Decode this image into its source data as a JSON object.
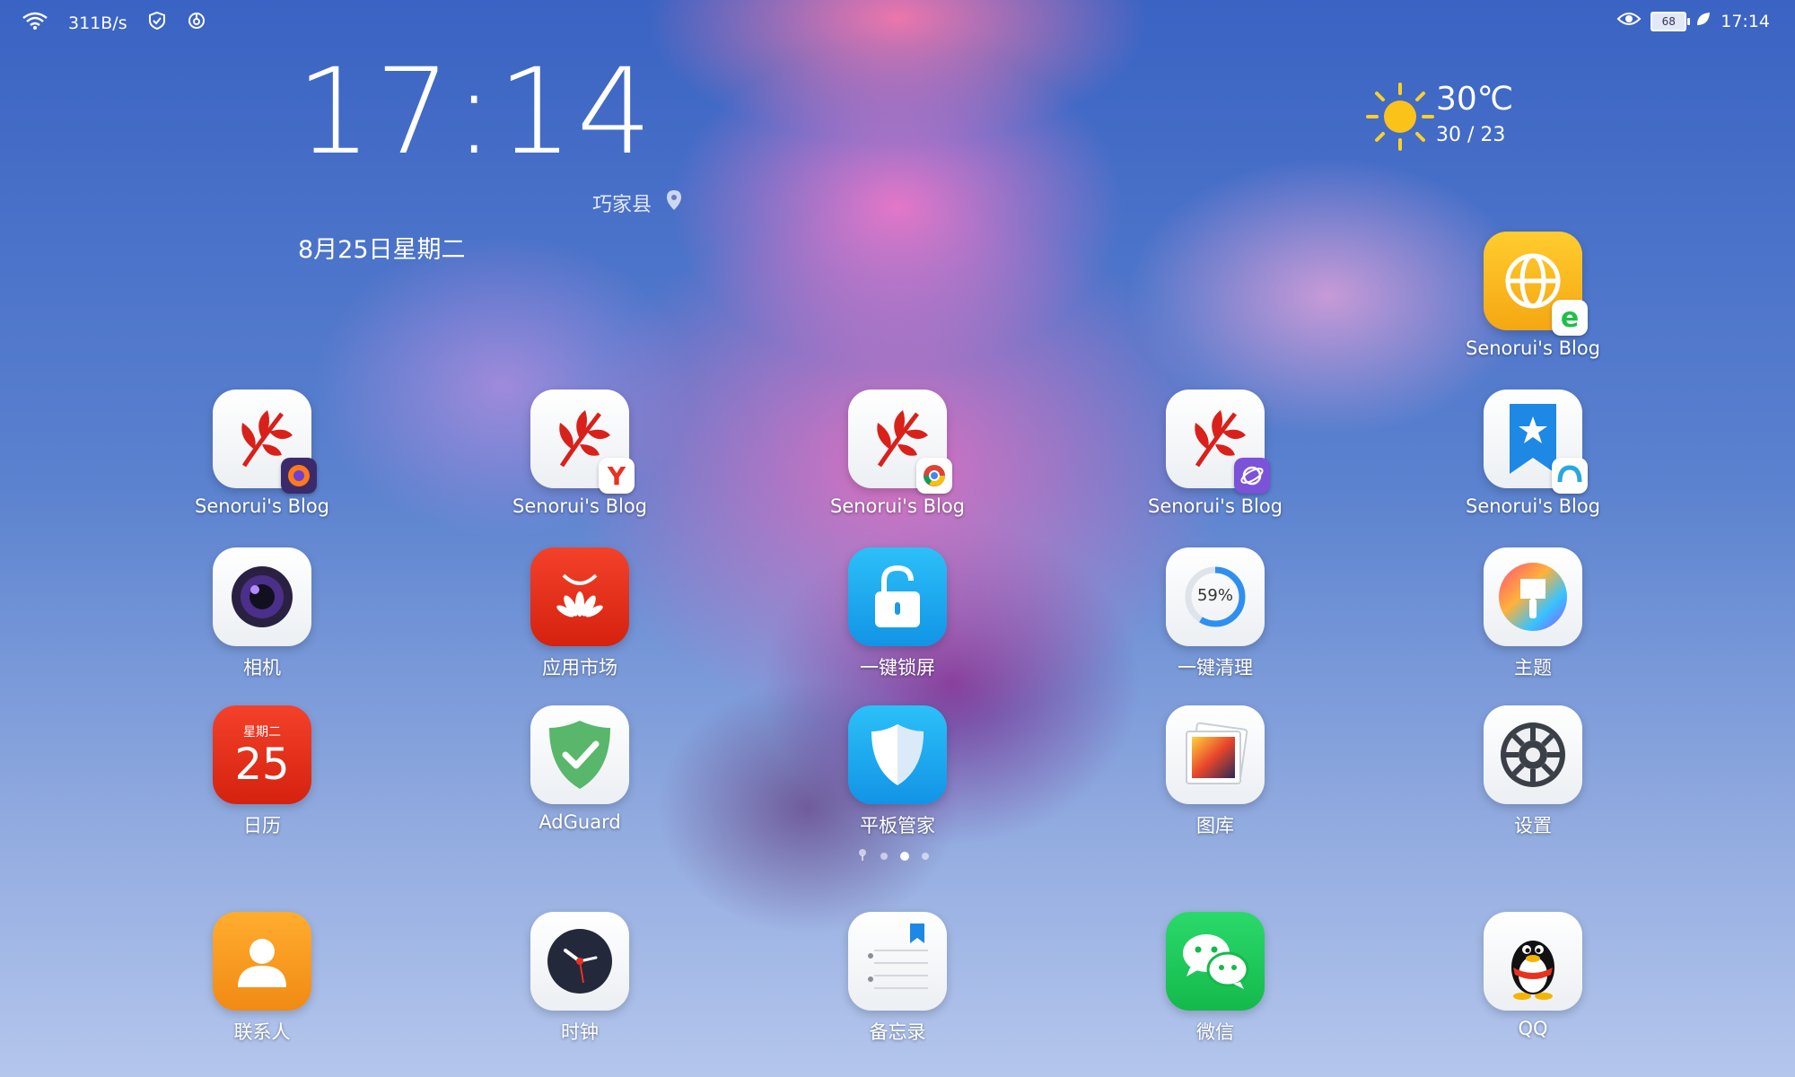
{
  "status_bar": {
    "net_speed": "311B/s",
    "battery_level": "68",
    "time": "17:14"
  },
  "clock_widget": {
    "time": "17:14",
    "location": "巧家县",
    "date": "8月25日星期二"
  },
  "weather_widget": {
    "temperature": "30℃",
    "range": "30 / 23",
    "icon": "sun-icon"
  },
  "apps": {
    "blog_e": "Senorui's Blog",
    "blog_firefox": "Senorui's Blog",
    "blog_yandex": "Senorui's Blog",
    "blog_chrome": "Senorui's Blog",
    "blog_browser": "Senorui's Blog",
    "blog_bookmark": "Senorui's Blog",
    "camera": "相机",
    "app_market": "应用市场",
    "lock_screen": "一键锁屏",
    "cleanup": "一键清理",
    "cleanup_percent": "59%",
    "themes": "主题",
    "calendar": "日历",
    "calendar_weekday": "星期二",
    "calendar_day": "25",
    "adguard": "AdGuard",
    "tablet_manager": "平板管家",
    "gallery": "图库",
    "settings": "设置"
  },
  "dock": {
    "contacts": "联系人",
    "clock": "时钟",
    "notes": "备忘录",
    "wechat": "微信",
    "qq": "QQ"
  },
  "colors": {
    "red_icon": "#e8321f",
    "blue_icon": "#1ea4f2",
    "wechat_green": "#1fc75a",
    "orange": "#f59a23",
    "yellow": "#fbbf1a"
  }
}
